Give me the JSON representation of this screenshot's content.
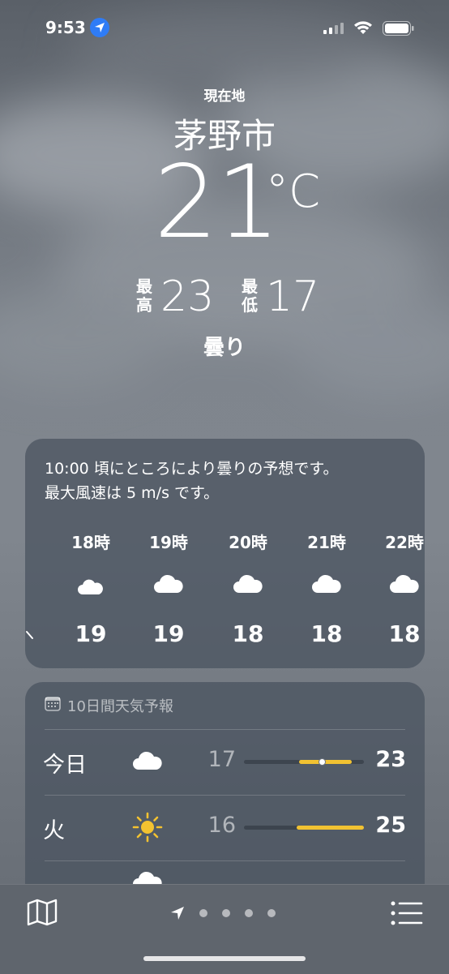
{
  "status_bar": {
    "time": "9:53",
    "location_icon": "location-arrow-icon",
    "signal_icon": "cellular-signal-icon",
    "wifi_icon": "wifi-icon",
    "battery_icon": "battery-icon"
  },
  "current": {
    "location_label": "現在地",
    "city": "茅野市",
    "temperature": "21",
    "unit": "°C",
    "high_label": "最高",
    "high_label_top": "最",
    "high_label_bottom": "高",
    "high": "23",
    "low_label": "最低",
    "low_label_top": "最",
    "low_label_bottom": "低",
    "low": "17",
    "condition": "曇り"
  },
  "hourly": {
    "summary_line1": "10:00 頃にところにより曇りの予想です。",
    "summary_line2": "最大風速は 5 m/s です。",
    "items": [
      {
        "label": "18時",
        "icon": "cloud-moon-icon",
        "temp": "19"
      },
      {
        "label": "19時",
        "icon": "cloud-icon",
        "temp": "19"
      },
      {
        "label": "20時",
        "icon": "cloud-icon",
        "temp": "18"
      },
      {
        "label": "21時",
        "icon": "cloud-icon",
        "temp": "18"
      },
      {
        "label": "22時",
        "icon": "cloud-icon",
        "temp": "18"
      }
    ]
  },
  "forecast": {
    "title": "10日間天気予報",
    "header_icon": "calendar-icon",
    "days": [
      {
        "day": "今日",
        "icon": "cloud-icon",
        "low": "17",
        "high": "23",
        "range_start": 0.46,
        "range_end": 0.9,
        "current": 0.65
      },
      {
        "day": "火",
        "icon": "sun-icon",
        "low": "16",
        "high": "25",
        "range_start": 0.44,
        "range_end": 1.0
      }
    ]
  },
  "toolbar": {
    "map_icon": "map-icon",
    "list_icon": "list-icon",
    "page_count": 4,
    "current_page_icon": "location-arrow-icon"
  },
  "colors": {
    "accent_bar": "#f1c232",
    "location_dot": "#2f7cf6"
  }
}
